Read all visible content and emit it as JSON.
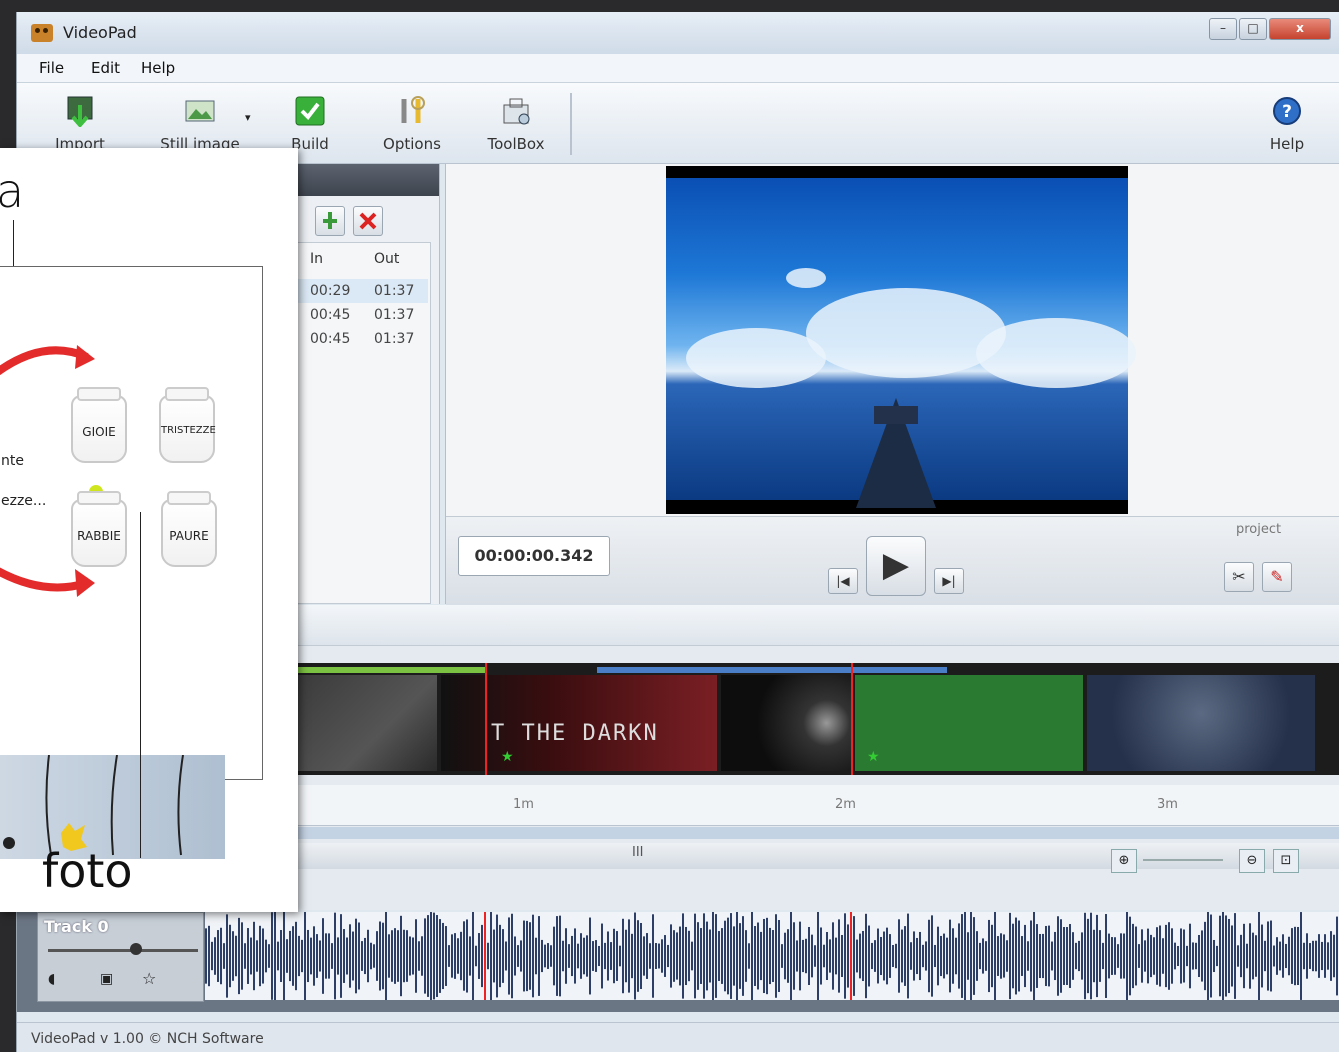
{
  "app": {
    "title": "VideoPad"
  },
  "window_buttons": {
    "minimize": "–",
    "maximize": "□",
    "close": "x"
  },
  "menu": [
    "File",
    "Edit",
    "Help"
  ],
  "toolbar": {
    "import": "Import",
    "still_image": "Still image",
    "build": "Build",
    "options": "Options",
    "toolbox": "ToolBox",
    "help": "Help"
  },
  "clip_bin": {
    "columns": [
      "In",
      "Out"
    ],
    "rows": [
      [
        "00:29",
        "01:37"
      ],
      [
        "00:45",
        "01:37"
      ],
      [
        "00:45",
        "01:37"
      ]
    ]
  },
  "preview": {
    "timecode": "00:00:00.342",
    "play": "▶",
    "prev": "|◀",
    "next": "▶|",
    "tab": "project"
  },
  "timeline": {
    "ruler_ticks": [
      "1m",
      "2m",
      "3m"
    ],
    "scroll_label": "III",
    "clip_text_1": "T THE DARKN"
  },
  "audio": {
    "track_name": "Track 0"
  },
  "status": {
    "text": "VideoPad v 1.00 © NCH Software"
  },
  "inset": {
    "callout_top": "a",
    "callout_bottom": "foto",
    "jars": [
      "GIOIE",
      "TRISTEZZE",
      "RABBIE",
      "PAURE"
    ],
    "text_1": "nte",
    "text_2": "ezze..."
  },
  "colors": {
    "accent": "#2f7fd0",
    "close": "#c5432f",
    "green_clip": "#2a7a32"
  }
}
